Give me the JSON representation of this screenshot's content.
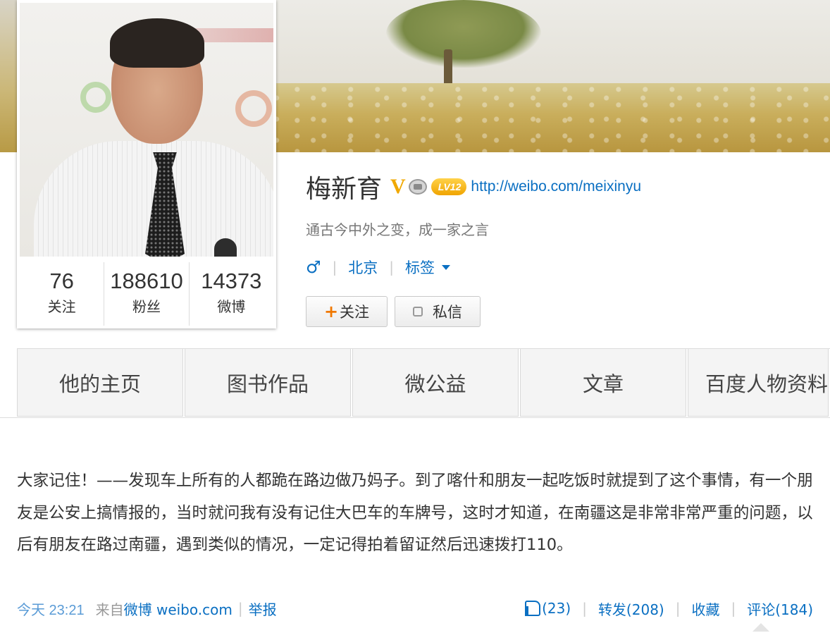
{
  "profile": {
    "name": "梅新育",
    "verified_mark": "V",
    "level": "LV12",
    "homepage_url": "http://weibo.com/meixinyu",
    "motto": "通古今中外之变，成一家之言",
    "gender_symbol": "♂",
    "city": "北京",
    "tags_label": "标签"
  },
  "stats": [
    {
      "count": "76",
      "label": "关注"
    },
    {
      "count": "188610",
      "label": "粉丝"
    },
    {
      "count": "14373",
      "label": "微博"
    }
  ],
  "buttons": {
    "follow_icon": "+",
    "follow_label": "关注",
    "message_label": "私信"
  },
  "tabs": [
    "他的主页",
    "图书作品",
    "微公益",
    "文章",
    "百度人物资料"
  ],
  "post": {
    "text": "大家记住！——发现车上所有的人都跪在路边做乃妈子。到了喀什和朋友一起吃饭时就提到了这个事情，有一个朋友是公安上搞情报的，当时就问我有没有记住大巴车的车牌号，这时才知道，在南疆这是非常非常严重的问题，以后有朋友在路过南疆，遇到类似的情况，一定记得拍着留证然后迅速拨打110。",
    "time": "今天 23:21",
    "from_prefix": "来自",
    "source": "微博 weibo.com",
    "report": "举报",
    "likes": "(23)",
    "repost": "转发(208)",
    "favorite": "收藏",
    "comment": "评论(184)"
  },
  "colors": {
    "link": "#0a6fc2",
    "accent_orange": "#f07800",
    "badge_gold": "#f0a800"
  },
  "icons": [
    "verified-icon",
    "crown-icon",
    "level-badge",
    "male-icon",
    "caret-down-icon",
    "plus-icon",
    "message-icon",
    "like-icon"
  ]
}
